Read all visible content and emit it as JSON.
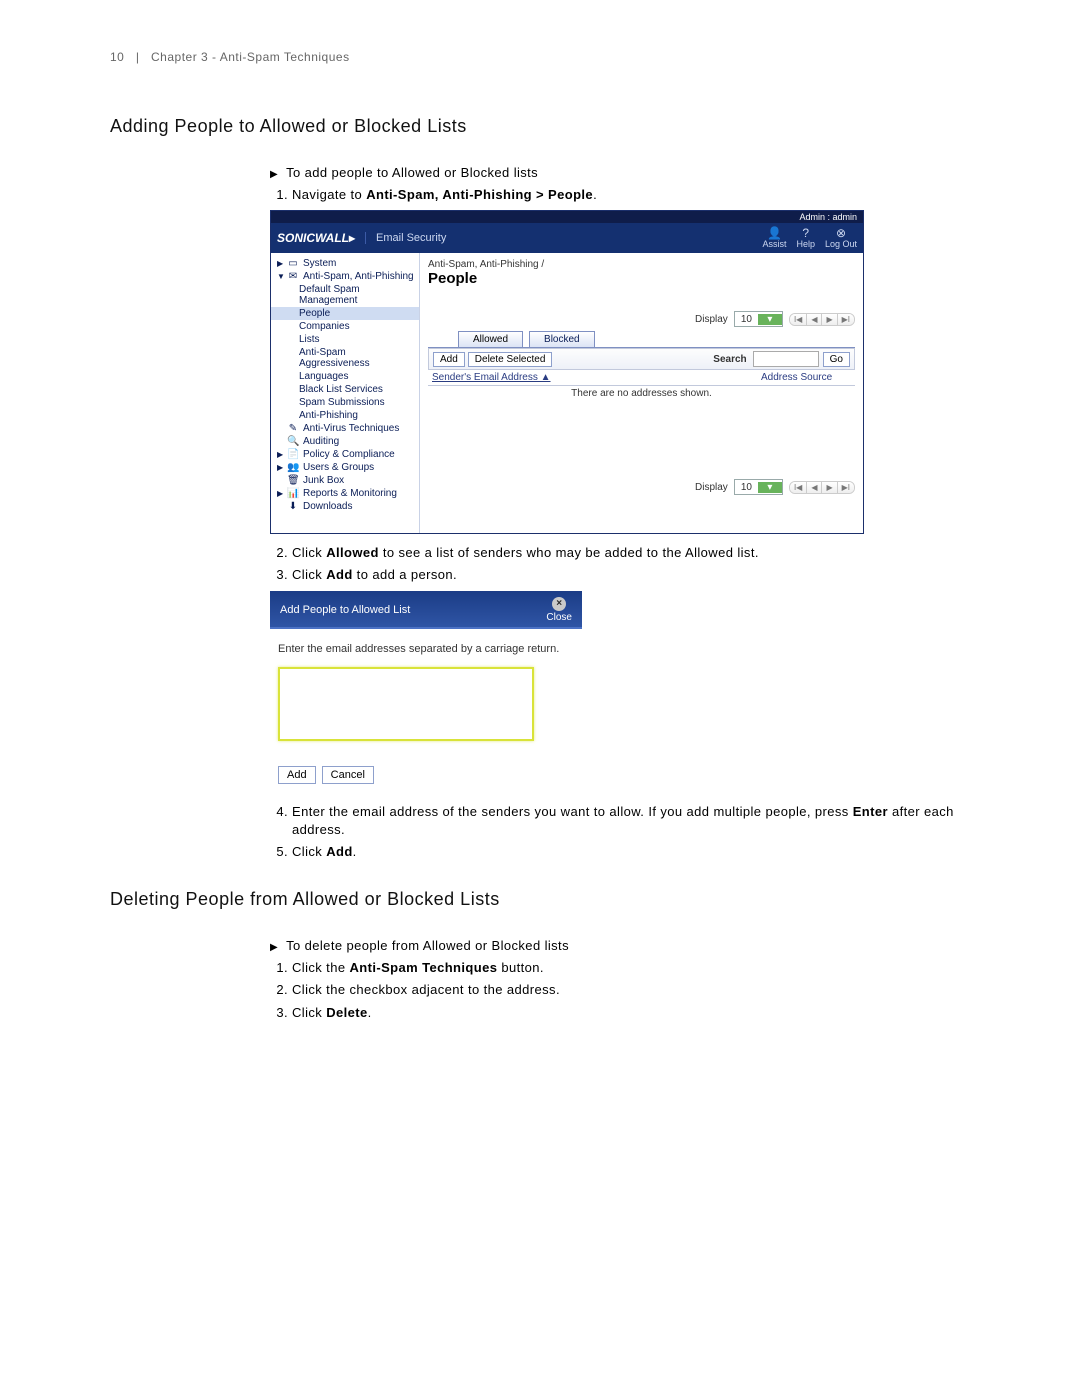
{
  "runhead": {
    "page": "10",
    "sep": "|",
    "chapter": "Chapter 3 - Anti-Spam Techniques"
  },
  "section1": {
    "heading": "Adding People to Allowed or Blocked Lists",
    "task": "To add people to Allowed or Blocked lists",
    "step1_a": "Navigate to ",
    "step1_b": "Anti-Spam, Anti-Phishing > People",
    "step1_c": ".",
    "step2_a": "Click ",
    "step2_b": "Allowed",
    "step2_c": " to see a list of senders who may be added to the Allowed list.",
    "step3_a": "Click ",
    "step3_b": "Add",
    "step3_c": " to add a person.",
    "step4_a": "Enter the email address of the senders you want to allow. If you add multiple people, press ",
    "step4_b": "Enter",
    "step4_c": " after each address.",
    "step5_a": "Click ",
    "step5_b": "Add",
    "step5_c": "."
  },
  "section2": {
    "heading": "Deleting People from Allowed or Blocked Lists",
    "task": "To delete people from Allowed or Blocked lists",
    "step1_a": "Click the ",
    "step1_b": "Anti-Spam Techniques",
    "step1_c": " button.",
    "step2": "Click the checkbox adjacent to the address.",
    "step3_a": "Click ",
    "step3_b": "Delete",
    "step3_c": "."
  },
  "app": {
    "userbar": "Admin : admin",
    "brand": "SONICWALL",
    "brand_arrow": "▸",
    "brand_sub": "Email Security",
    "header_icons": {
      "assist": "Assist",
      "help": "Help",
      "logout": "Log Out"
    },
    "nav": {
      "system": "System",
      "antispam": "Anti-Spam, Anti-Phishing",
      "default_spam": "Default Spam Management",
      "people": "People",
      "companies": "Companies",
      "lists": "Lists",
      "aggr": "Anti-Spam Aggressiveness",
      "languages": "Languages",
      "blacklist": "Black List Services",
      "spamsub": "Spam Submissions",
      "antiphish": "Anti-Phishing",
      "antivirus": "Anti-Virus Techniques",
      "auditing": "Auditing",
      "policy": "Policy & Compliance",
      "users": "Users & Groups",
      "junk": "Junk Box",
      "reports": "Reports & Monitoring",
      "downloads": "Downloads"
    },
    "main": {
      "crumb": "Anti-Spam, Anti-Phishing /",
      "title": "People",
      "display_label": "Display",
      "display_value": "10",
      "tabs": {
        "allowed": "Allowed",
        "blocked": "Blocked"
      },
      "btn_add": "Add",
      "btn_del": "Delete Selected",
      "search_label": "Search",
      "btn_go": "Go",
      "col_email": "Sender's Email Address ▲",
      "col_source": "Address Source",
      "empty": "There are no addresses shown."
    }
  },
  "dialog": {
    "title": "Add People to Allowed List",
    "close": "Close",
    "instr": "Enter the email addresses separated by a carriage return.",
    "btn_add": "Add",
    "btn_cancel": "Cancel"
  }
}
